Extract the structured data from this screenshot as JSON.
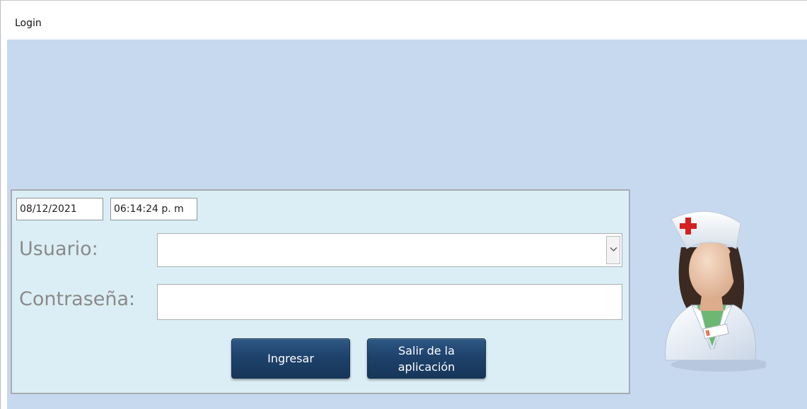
{
  "window": {
    "title": "Login"
  },
  "form": {
    "date": "08/12/2021",
    "time": "06:14:24 p. m",
    "user_label": "Usuario:",
    "user_value": "",
    "password_label": "Contraseña:",
    "password_value": "",
    "login_button": "Ingresar",
    "exit_button": "Salir de la aplicación"
  },
  "icons": {
    "combo_arrow": "chevron-down-icon",
    "avatar": "nurse-avatar-icon"
  },
  "colors": {
    "form_background": "#c7d9ef",
    "panel_background": "#dbeef5",
    "button": "#1e426c",
    "label_text": "#8a8a8a",
    "cross": "#d61f1f"
  }
}
